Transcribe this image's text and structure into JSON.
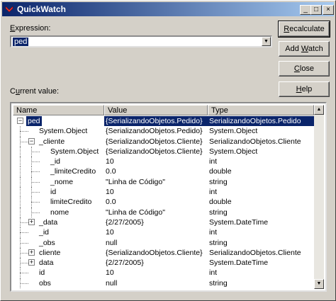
{
  "window": {
    "title": "QuickWatch",
    "controls": {
      "minimize": "_",
      "maximize": "□",
      "close": "×"
    }
  },
  "expression": {
    "label_underline": "E",
    "label_rest": "xpression:",
    "value": "ped"
  },
  "buttons": {
    "recalculate_u": "R",
    "recalculate_rest": "ecalculate",
    "addwatch_pre": "Add ",
    "addwatch_u": "W",
    "addwatch_rest": "atch",
    "close_u": "C",
    "close_rest": "lose",
    "help_u": "H",
    "help_rest": "elp"
  },
  "current_value": {
    "label_pre": "C",
    "label_u": "u",
    "label_rest": "rrent value:"
  },
  "grid": {
    "columns": [
      "Name",
      "Value",
      "Type"
    ],
    "rows": [
      {
        "name": "ped",
        "value": "{SerializandoObjetos.Pedido}",
        "type": "SerializandoObjetos.Pedido",
        "depth": 0,
        "expander": "minus",
        "selected": true
      },
      {
        "name": "System.Object",
        "value": "{SerializandoObjetos.Pedido}",
        "type": "System.Object",
        "depth": 1,
        "expander": "none"
      },
      {
        "name": "_cliente",
        "value": "{SerializandoObjetos.Cliente}",
        "type": "SerializandoObjetos.Cliente",
        "depth": 1,
        "expander": "minus"
      },
      {
        "name": "System.Object",
        "value": "{SerializandoObjetos.Cliente}",
        "type": "System.Object",
        "depth": 2,
        "expander": "none"
      },
      {
        "name": "_id",
        "value": "10",
        "type": "int",
        "depth": 2,
        "expander": "none"
      },
      {
        "name": "_limiteCredito",
        "value": "0.0",
        "type": "double",
        "depth": 2,
        "expander": "none"
      },
      {
        "name": "_nome",
        "value": "\"Linha de Código\"",
        "type": "string",
        "depth": 2,
        "expander": "none"
      },
      {
        "name": "id",
        "value": "10",
        "type": "int",
        "depth": 2,
        "expander": "none"
      },
      {
        "name": "limiteCredito",
        "value": "0.0",
        "type": "double",
        "depth": 2,
        "expander": "none"
      },
      {
        "name": "nome",
        "value": "\"Linha de Código\"",
        "type": "string",
        "depth": 2,
        "expander": "none"
      },
      {
        "name": "_data",
        "value": "{2/27/2005}",
        "type": "System.DateTime",
        "depth": 1,
        "expander": "plus"
      },
      {
        "name": "_id",
        "value": "10",
        "type": "int",
        "depth": 1,
        "expander": "none"
      },
      {
        "name": "_obs",
        "value": "null",
        "type": "string",
        "depth": 1,
        "expander": "none"
      },
      {
        "name": "cliente",
        "value": "{SerializandoObjetos.Cliente}",
        "type": "SerializandoObjetos.Cliente",
        "depth": 1,
        "expander": "plus"
      },
      {
        "name": "data",
        "value": "{2/27/2005}",
        "type": "System.DateTime",
        "depth": 1,
        "expander": "plus"
      },
      {
        "name": "id",
        "value": "10",
        "type": "int",
        "depth": 1,
        "expander": "none"
      },
      {
        "name": "obs",
        "value": "null",
        "type": "string",
        "depth": 1,
        "expander": "none"
      }
    ]
  },
  "colors": {
    "selection": "#0a246a",
    "face": "#d4d0c8"
  }
}
